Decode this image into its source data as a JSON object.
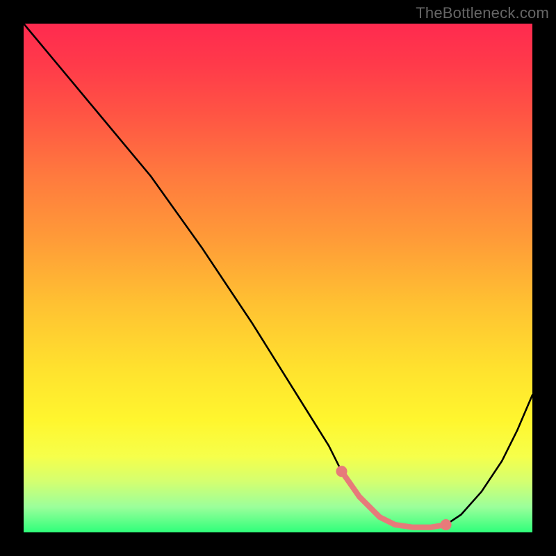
{
  "attribution": "TheBottleneck.com",
  "chart_data": {
    "type": "line",
    "title": "",
    "xlabel": "",
    "ylabel": "",
    "xlim": [
      0,
      100
    ],
    "ylim": [
      0,
      100
    ],
    "grid": false,
    "legend": "none",
    "series": [
      {
        "name": "bottleneck-curve",
        "color": "#000000",
        "x": [
          0,
          5,
          10,
          15,
          20,
          25,
          30,
          35,
          40,
          45,
          50,
          55,
          60,
          62.5,
          66,
          70,
          73,
          76.5,
          80,
          83,
          86,
          90,
          94,
          97,
          100
        ],
        "values": [
          100,
          94,
          88,
          82,
          76,
          70,
          63,
          56,
          48.5,
          41,
          33,
          25,
          17,
          12,
          7,
          3,
          1.5,
          1,
          1,
          1.5,
          3.5,
          8,
          14,
          20,
          27
        ]
      }
    ],
    "highlight_band": {
      "name": "flat-region",
      "color": "#e77a7a",
      "endpoint_radius_pct": 1.1,
      "stroke_width_pct": 1.1,
      "x_start": 62.5,
      "x_end": 83,
      "points_x": [
        62.5,
        66,
        70,
        73,
        76.5,
        80,
        83
      ],
      "points_y": [
        12,
        7,
        3,
        1.5,
        1,
        1,
        1.5
      ]
    }
  }
}
